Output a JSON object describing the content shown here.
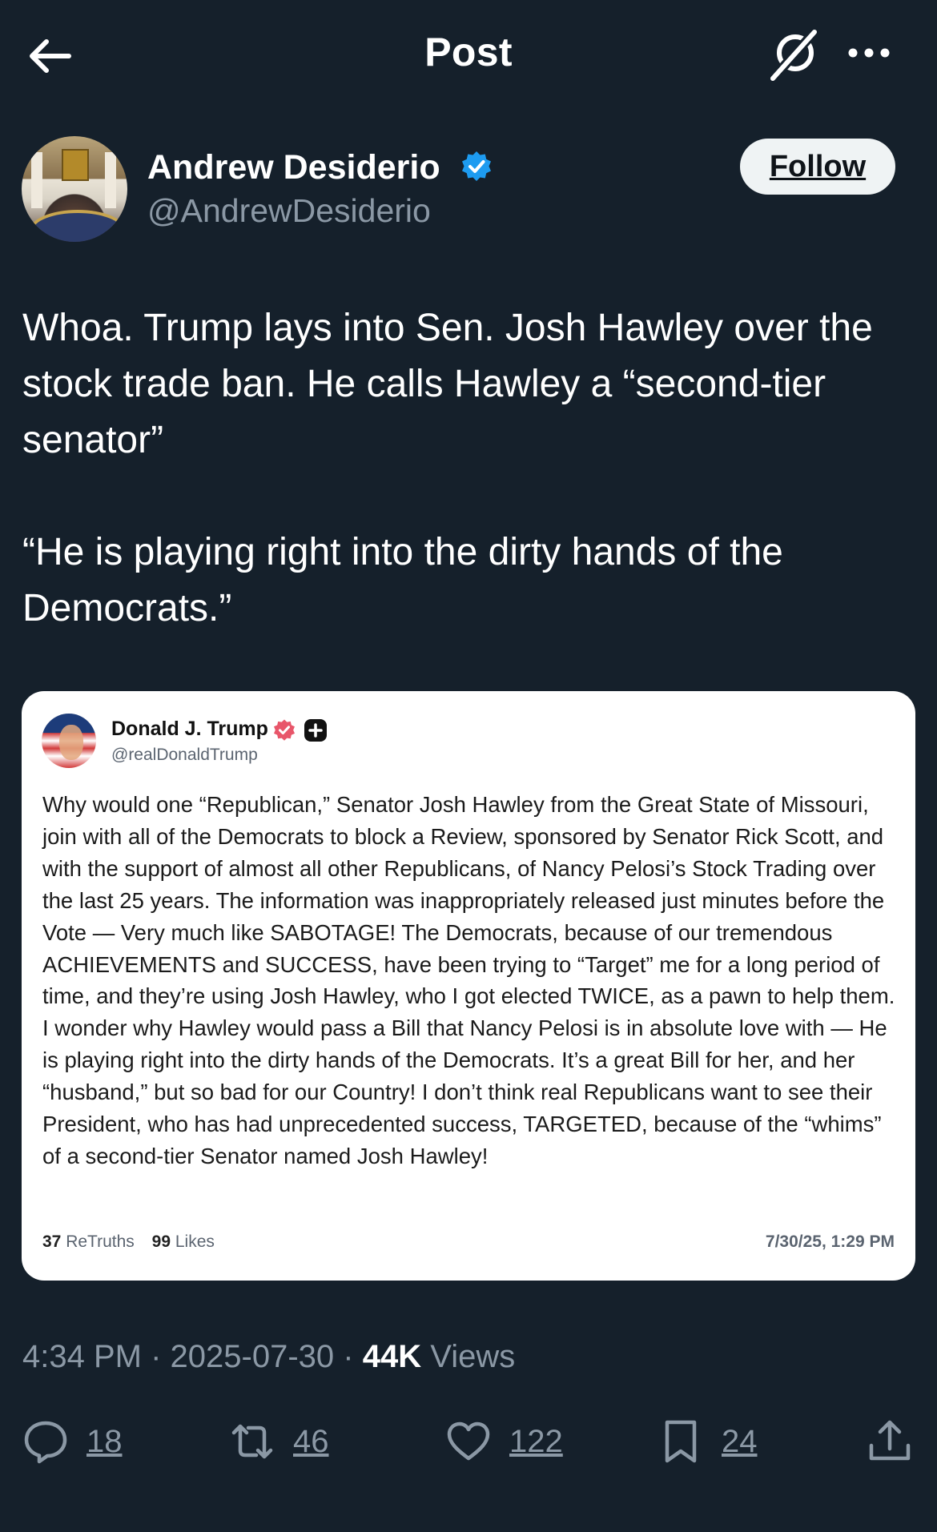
{
  "header": {
    "title": "Post",
    "back_icon": "arrow-left-icon",
    "grok_icon": "grok-icon",
    "more_icon": "more-dots-icon"
  },
  "author": {
    "name": "Andrew Desiderio",
    "handle": "@AndrewDesiderio",
    "verified": true,
    "follow_label": "Follow"
  },
  "tweet": {
    "paragraphs": [
      "Whoa. Trump lays into Sen. Josh Hawley over the stock trade ban. He calls Hawley a “second-tier senator”",
      "“He is playing right into the dirty hands of the Democrats.”"
    ]
  },
  "embedded_post": {
    "name": "Donald J. Trump",
    "handle": "@realDonaldTrump",
    "text": "Why would one “Republican,” Senator Josh Hawley from the Great State of Missouri, join with all of the Democrats to block a Review, sponsored by Senator Rick Scott, and with the support of almost all other Republicans, of Nancy Pelosi’s Stock Trading over the last 25 years. The information was inappropriately released just minutes before the Vote — Very much like SABOTAGE! The Democrats, because of our tremendous ACHIEVEMENTS and SUCCESS, have been trying to “Target” me for a long period of time, and they’re using Josh Hawley, who I got elected TWICE, as a pawn to help them. I wonder why Hawley would pass a Bill that Nancy Pelosi is in absolute love with — He is playing right into the dirty hands of the Democrats. It’s a great Bill for her, and her “husband,” but so bad for our Country! I don’t think real Republicans want to see their President, who has had unprecedented success, TARGETED, because of the “whims” of a second-tier Senator named Josh Hawley!",
    "retruths_count": "37",
    "retruths_label": "ReTruths",
    "likes_count": "99",
    "likes_label": "Likes",
    "date": "7/30/25, 1:29 PM"
  },
  "meta": {
    "time": "4:34 PM",
    "separator": "·",
    "date": "2025-07-30",
    "views_count": "44K",
    "views_label": "Views"
  },
  "actions": {
    "replies": "18",
    "reposts": "46",
    "likes": "122",
    "bookmarks": "24"
  },
  "colors": {
    "background": "#15202b",
    "accent": "#1d9bf0",
    "muted": "#8b98a5"
  }
}
